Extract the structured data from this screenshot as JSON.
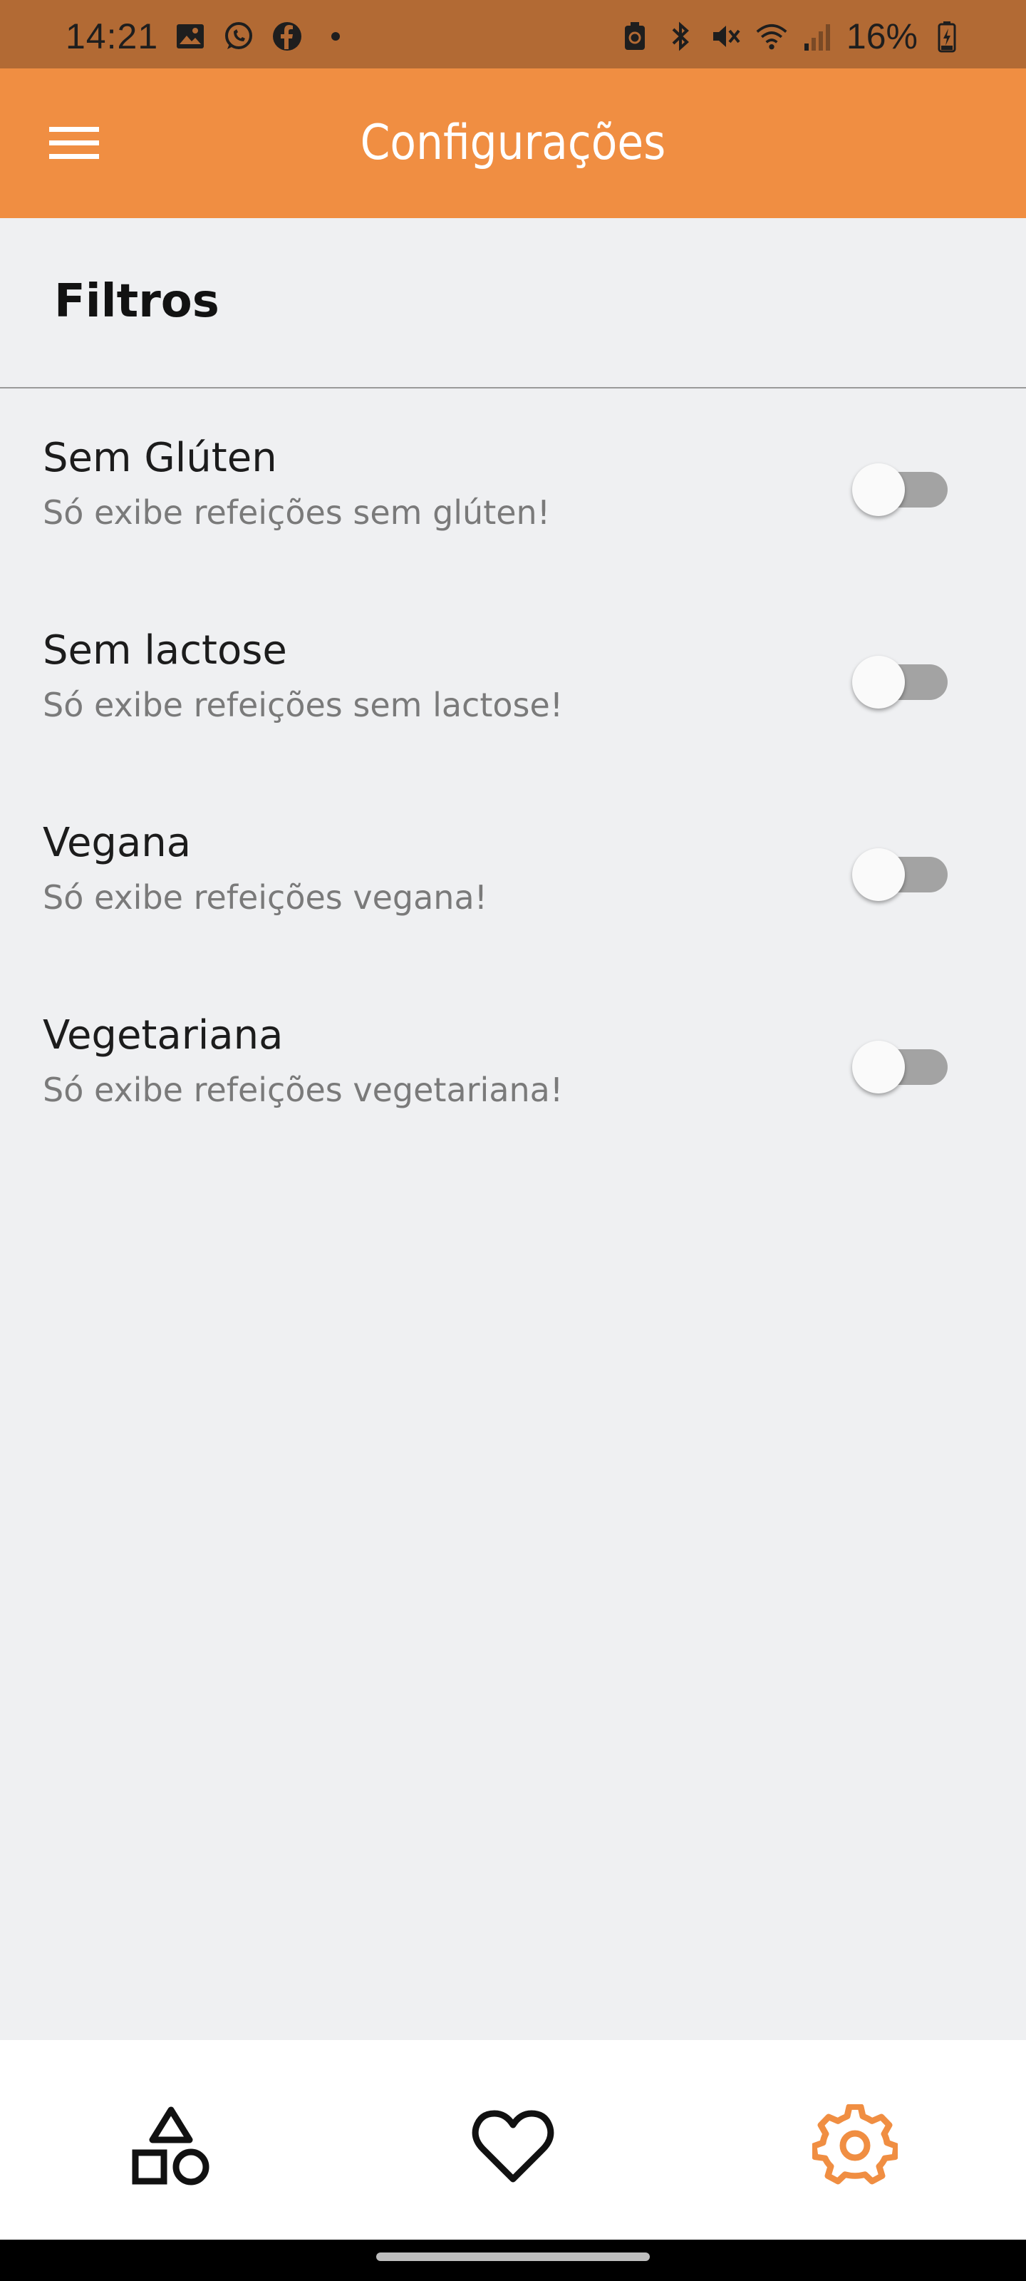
{
  "status_bar": {
    "time": "14:21",
    "battery": "16%",
    "left_icons": [
      "gallery-icon",
      "whatsapp-icon",
      "facebook-icon",
      "dot-icon"
    ],
    "right_icons": [
      "battery-saver-icon",
      "bluetooth-icon",
      "mute-icon",
      "wifi-icon",
      "signal-icon",
      "battery-icon"
    ]
  },
  "app_bar": {
    "title": "Configurações",
    "menu_icon": "hamburger-menu-icon"
  },
  "section": {
    "title": "Filtros"
  },
  "filters": [
    {
      "title": "Sem Glúten",
      "subtitle": "Só exibe refeições sem glúten!",
      "enabled": false
    },
    {
      "title": "Sem lactose",
      "subtitle": "Só exibe refeições sem lactose!",
      "enabled": false
    },
    {
      "title": "Vegana",
      "subtitle": "Só exibe refeições vegana!",
      "enabled": false
    },
    {
      "title": "Vegetariana",
      "subtitle": "Só exibe refeições vegetariana!",
      "enabled": false
    }
  ],
  "bottom_nav": {
    "items": [
      {
        "icon": "categories-shapes-icon",
        "active": false
      },
      {
        "icon": "heart-icon",
        "active": false
      },
      {
        "icon": "gear-icon",
        "active": true
      }
    ]
  },
  "colors": {
    "status_bar": "#B26A34",
    "app_bar": "#F08E42",
    "background": "#EFF0F2",
    "active_icon": "#F08E42",
    "inactive_icon": "#111111",
    "switch_track": "#A3A3A3",
    "switch_thumb": "#FAFAFA"
  }
}
